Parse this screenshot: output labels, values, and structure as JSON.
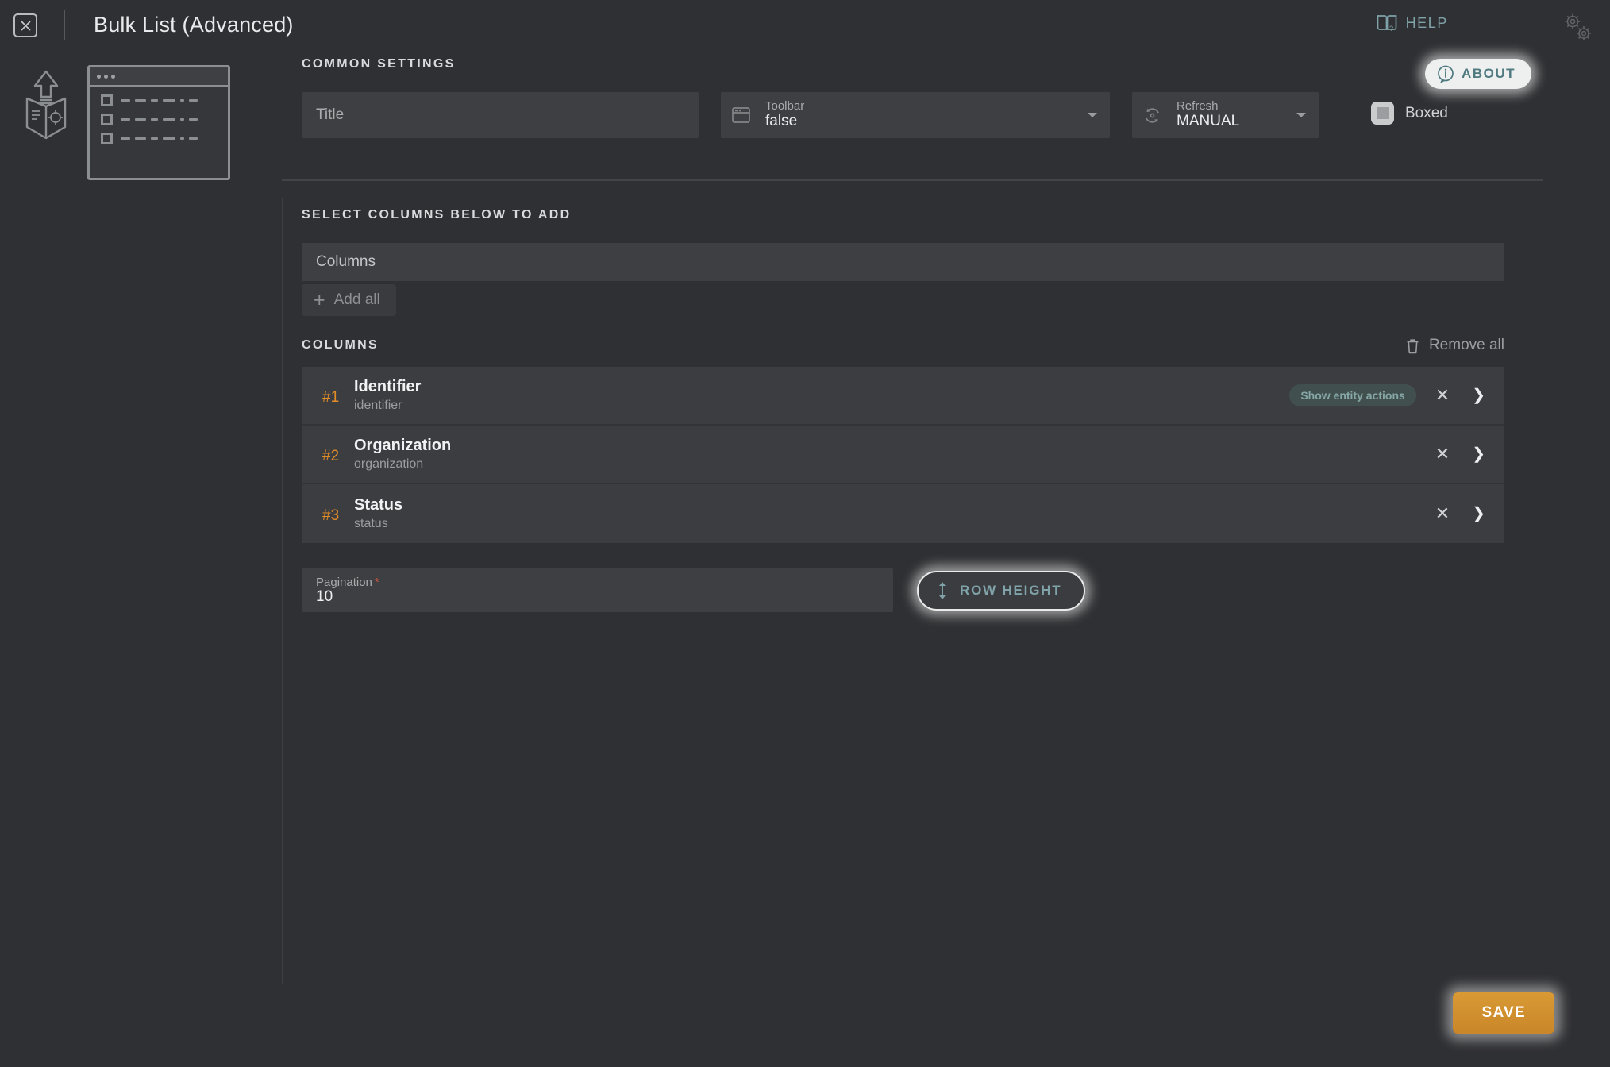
{
  "header": {
    "close_icon": "close-x-icon",
    "title": "Bulk List (Advanced)",
    "help_label": "HELP",
    "help_icon": "book-question-icon",
    "gears_icon": "gears-icon",
    "about_label": "ABOUT",
    "about_icon": "info-circle-icon"
  },
  "rail": {
    "cube_icon": "package-upload-icon",
    "preview_icon": "list-window-preview"
  },
  "common": {
    "section_title": "COMMON SETTINGS",
    "title_field": {
      "label": "Title",
      "value": "",
      "placeholder": "Title"
    },
    "toolbar_field": {
      "label": "Toolbar",
      "value": "false",
      "icon": "toolbar-icon"
    },
    "refresh_field": {
      "label": "Refresh",
      "value": "MANUAL",
      "icon": "refresh-icon"
    },
    "boxed": {
      "label": "Boxed",
      "checked": false
    }
  },
  "select_columns": {
    "section_title": "SELECT COLUMNS BELOW TO ADD",
    "dropdown_placeholder": "Columns",
    "add_all_label": "Add all",
    "add_all_icon": "plus-icon"
  },
  "columns": {
    "section_title": "COLUMNS",
    "remove_all_label": "Remove all",
    "remove_all_icon": "trash-icon",
    "rows": [
      {
        "num": "#1",
        "name": "Identifier",
        "key": "identifier",
        "badge": "Show entity actions"
      },
      {
        "num": "#2",
        "name": "Organization",
        "key": "organization",
        "badge": ""
      },
      {
        "num": "#3",
        "name": "Status",
        "key": "status",
        "badge": ""
      }
    ],
    "remove_icon": "close-x-icon",
    "expand_icon": "chevron-down-icon"
  },
  "bottom": {
    "pagination": {
      "label": "Pagination",
      "required_mark": "*",
      "value": "10"
    },
    "row_height_label": "ROW HEIGHT",
    "row_height_icon": "vertical-resize-icon"
  },
  "footer": {
    "save_label": "SAVE"
  },
  "colors": {
    "background": "#2f3033",
    "panel": "#3e3f42",
    "accent_orange": "#e08c28",
    "accent_teal": "#7fa3a8",
    "required_red": "#d9593f",
    "save_orange": "#d99a34"
  }
}
